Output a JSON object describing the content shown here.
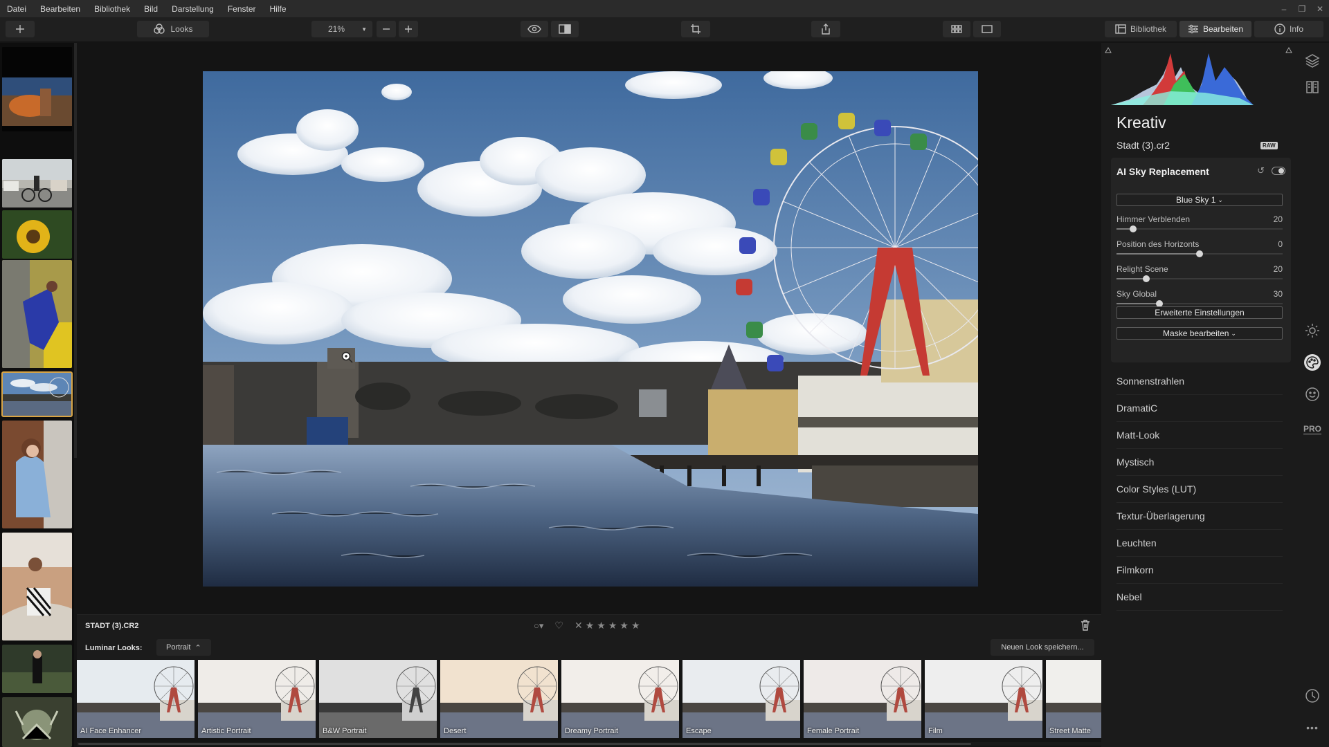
{
  "menubar": {
    "items": [
      "Datei",
      "Bearbeiten",
      "Bibliothek",
      "Bild",
      "Darstellung",
      "Fenster",
      "Hilfe"
    ]
  },
  "toolbar": {
    "looks_label": "Looks",
    "zoom": "21%",
    "tabs": [
      {
        "label": "Bibliothek",
        "icon": "library-icon"
      },
      {
        "label": "Bearbeiten",
        "icon": "sliders-icon"
      },
      {
        "label": "Info",
        "icon": "info-icon"
      }
    ]
  },
  "info": {
    "filename": "STADT (3).CR2"
  },
  "looks": {
    "label": "Luminar Looks:",
    "category": "Portrait",
    "save_label": "Neuen Look speichern...",
    "items": [
      "AI Face Enhancer",
      "Artistic Portrait",
      "B&W Portrait",
      "Desert",
      "Dreamy Portrait",
      "Escape",
      "Female Portrait",
      "Film",
      "Street Matte"
    ]
  },
  "panel": {
    "title": "Kreativ",
    "file": "Stadt (3).cr2",
    "raw_badge": "RAW",
    "sky": {
      "header": "AI Sky Replacement",
      "sky_select": "Blue Sky 1",
      "sliders": [
        {
          "label": "Himmer Verblenden",
          "value": "20",
          "pos": 0.1
        },
        {
          "label": "Position des Horizonts",
          "value": "0",
          "pos": 0.5
        },
        {
          "label": "Relight Scene",
          "value": "20",
          "pos": 0.18
        },
        {
          "label": "Sky Global",
          "value": "30",
          "pos": 0.26
        }
      ],
      "advanced_label": "Erweiterte Einstellungen",
      "mask_label": "Maske bearbeiten"
    },
    "categories": [
      "Sonnenstrahlen",
      "DramatiC",
      "Matt-Look",
      "Mystisch",
      "Color Styles (LUT)",
      "Textur-Überlagerung",
      "Leuchten",
      "Filmkorn",
      "Nebel"
    ]
  },
  "iconbar": {
    "pro_label": "PRO"
  }
}
